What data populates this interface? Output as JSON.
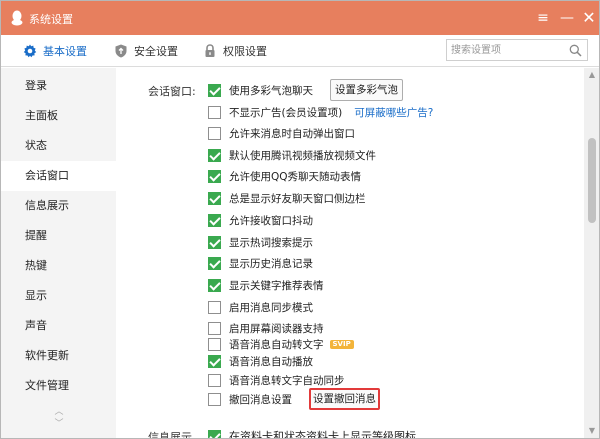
{
  "titlebar": {
    "title": "系统设置",
    "menu_glyph": "≡",
    "min_glyph": "—",
    "close_glyph": "✕"
  },
  "tabs": [
    {
      "label": "基本设置",
      "icon": "gear-icon",
      "active": true
    },
    {
      "label": "安全设置",
      "icon": "shield-icon",
      "active": false
    },
    {
      "label": "权限设置",
      "icon": "lock-icon",
      "active": false
    }
  ],
  "search": {
    "placeholder": "搜索设置项",
    "value": ""
  },
  "sidebar": {
    "items": [
      {
        "label": "登录"
      },
      {
        "label": "主面板"
      },
      {
        "label": "状态"
      },
      {
        "label": "会话窗口",
        "active": true
      },
      {
        "label": "信息展示"
      },
      {
        "label": "提醒"
      },
      {
        "label": "热键"
      },
      {
        "label": "显示"
      },
      {
        "label": "声音"
      },
      {
        "label": "软件更新"
      },
      {
        "label": "文件管理"
      }
    ],
    "scroll_up": "︿",
    "scroll_down": "﹀"
  },
  "content": {
    "section_label": "会话窗口:",
    "options": [
      {
        "label": "使用多彩气泡聊天",
        "checked": true
      },
      {
        "label": "不显示广告(会员设置项)",
        "checked": false
      },
      {
        "label": "允许来消息时自动弹出窗口",
        "checked": false
      },
      {
        "label": "默认使用腾讯视频播放视频文件",
        "checked": true
      },
      {
        "label": "允许使用QQ秀聊天随动表情",
        "checked": true
      },
      {
        "label": "总是显示好友聊天窗口侧边栏",
        "checked": true
      },
      {
        "label": "允许接收窗口抖动",
        "checked": true
      },
      {
        "label": "显示热词搜索提示",
        "checked": true
      },
      {
        "label": "显示历史消息记录",
        "checked": true
      },
      {
        "label": "显示关键字推荐表情",
        "checked": true
      },
      {
        "label": "启用消息同步模式",
        "checked": false
      },
      {
        "label": "启用屏幕阅读器支持",
        "checked": false
      },
      {
        "label": "语音消息自动转文字",
        "checked": false,
        "badge": "SVIP"
      },
      {
        "label": "语音消息自动播放",
        "checked": true
      },
      {
        "label": "语音消息转文字自动同步",
        "checked": false
      },
      {
        "label": "撤回消息设置",
        "checked": false
      }
    ],
    "bubble_button": "设置多彩气泡",
    "ad_link": "可屏蔽哪些广告?",
    "recall_button": "设置撤回消息",
    "next_section_label": "信息展示",
    "next_option": "在资料卡和状态资料卡上显示等级图标"
  },
  "scrollbar": {
    "up": "▲",
    "down": "▼"
  },
  "colors": {
    "titlebar": "#e77f5e",
    "accent": "#1a6dc8",
    "check": "#3aa94f",
    "highlight": "#e23a3a",
    "badge": "#f3b43a"
  }
}
